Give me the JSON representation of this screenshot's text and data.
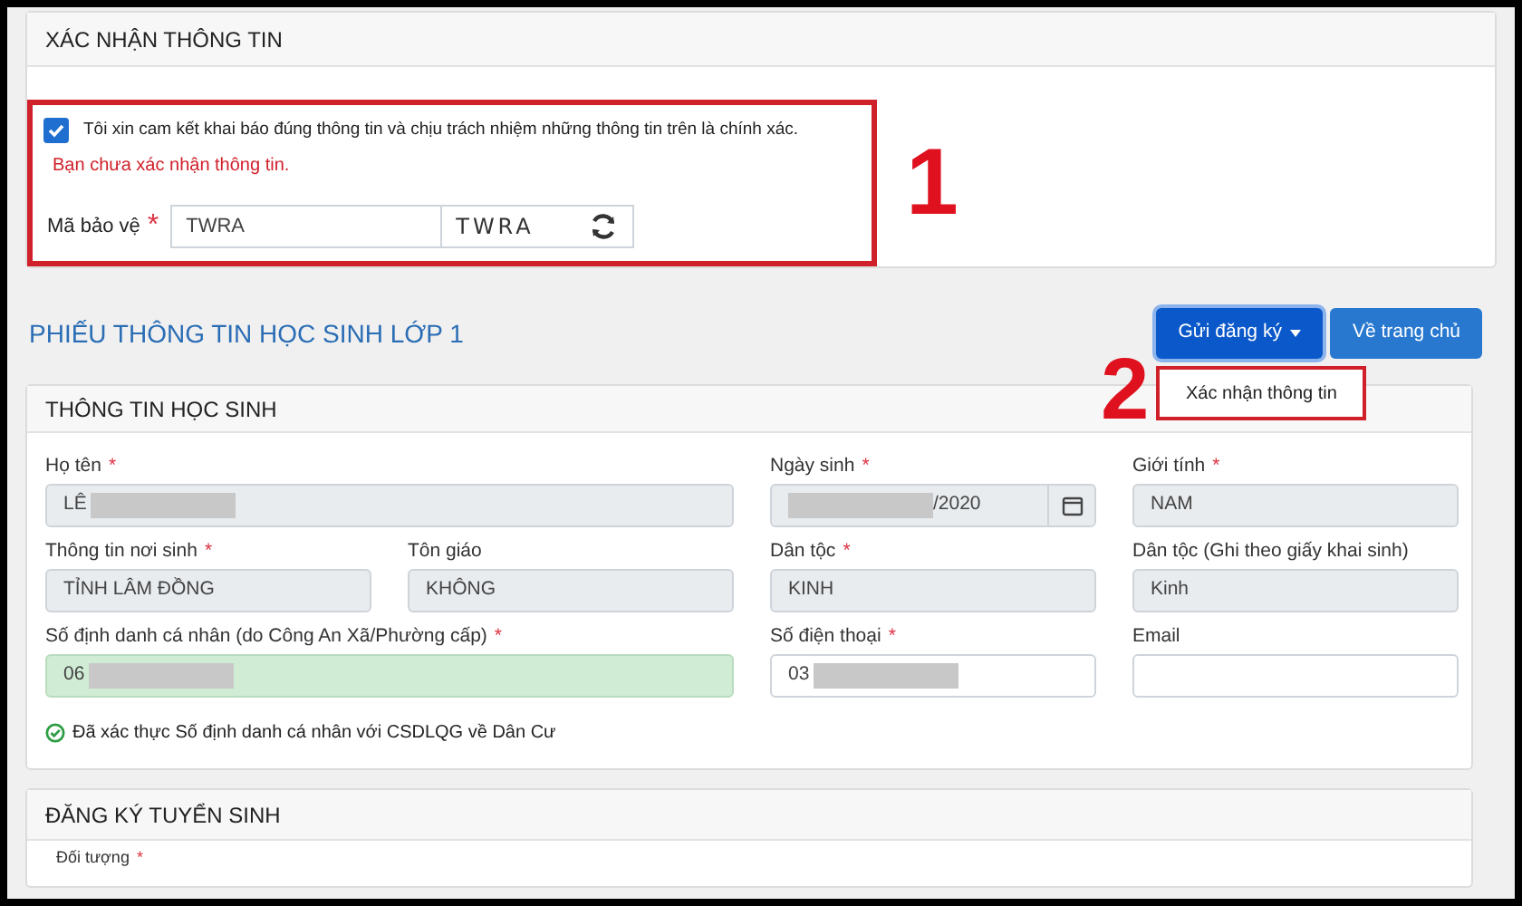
{
  "confirm_section": {
    "title": "XÁC NHẬN THÔNG TIN",
    "commitment": {
      "label": "Tôi xin cam kết khai báo đúng thông tin và chịu trách nhiệm những thông tin trên là chính xác.",
      "checked": true
    },
    "error": "Bạn chưa xác nhận thông tin.",
    "captcha": {
      "label": "Mã bảo vệ",
      "required_mark": "*",
      "value": "TWRA",
      "image_text": "TWRA"
    }
  },
  "annotations": [
    {
      "label": "1"
    },
    {
      "label": "2"
    }
  ],
  "form_title": "PHIẾU THÔNG TIN HỌC SINH LỚP 1",
  "buttons": [
    {
      "label": "Gửi đăng ký",
      "kind": "dropdown",
      "selected": true
    },
    {
      "label": "Về trang chủ",
      "kind": "plain",
      "selected": false
    }
  ],
  "dropdown_menu": {
    "items": [
      {
        "label": "Xác nhận thông tin"
      }
    ]
  },
  "student_section": {
    "title": "THÔNG TIN HỌC SINH",
    "fields": [
      {
        "label": "Họ tên",
        "required_mark": "*",
        "value": "LÊ",
        "readonly": true,
        "verified": false,
        "kind": "wide",
        "redacted": true
      },
      {
        "label": "Ngày sinh",
        "required_mark": "*",
        "value": "/2020",
        "readonly": true,
        "verified": false,
        "kind": "date",
        "redacted": true
      },
      {
        "label": "Giới tính",
        "required_mark": "*",
        "value": "NAM",
        "readonly": true,
        "verified": false,
        "kind": "text"
      },
      {
        "label": "Thông tin nơi sinh",
        "required_mark": "*",
        "value": "TỈNH LÂM ĐỒNG",
        "readonly": true,
        "verified": false,
        "kind": "text"
      },
      {
        "label": "Tôn giáo",
        "value": "KHÔNG",
        "readonly": true,
        "verified": false,
        "kind": "text"
      },
      {
        "label": "Dân tộc",
        "required_mark": "*",
        "value": "KINH",
        "readonly": true,
        "verified": false,
        "kind": "text"
      },
      {
        "label": "Dân tộc (Ghi theo giấy khai sinh)",
        "value": "Kinh",
        "readonly": true,
        "verified": false,
        "kind": "text"
      },
      {
        "label": "Số định danh cá nhân (do Công An Xã/Phường cấp)",
        "required_mark": "*",
        "value": "06",
        "verified": true,
        "kind": "wide",
        "redacted": true
      },
      {
        "label": "Số điện thoại",
        "required_mark": "*",
        "value": "03",
        "readonly": false,
        "verified": false,
        "kind": "text",
        "redacted": true
      },
      {
        "label": "Email",
        "readonly": false,
        "verified": false,
        "kind": "text"
      }
    ],
    "verified_note": "Đã xác thực Số định danh cá nhân với CSDLQG về Dân Cư"
  },
  "registration_section": {
    "title": "ĐĂNG KÝ TUYỂN SINH",
    "fields": [
      {
        "label": "Đối tượng",
        "required_mark": "*"
      }
    ]
  }
}
